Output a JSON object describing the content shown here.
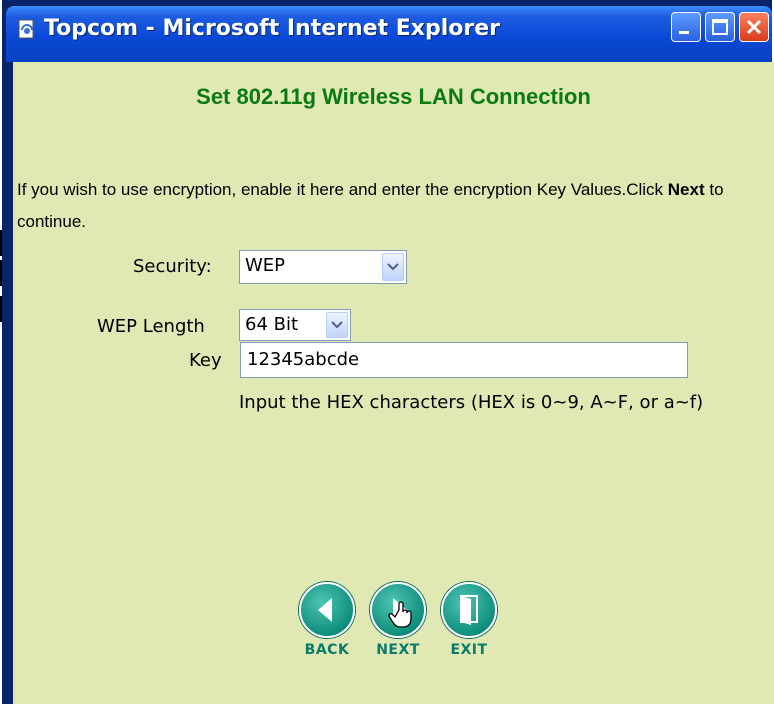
{
  "window": {
    "title": "Topcom - Microsoft Internet Explorer",
    "title_icon": "ie-page-icon",
    "controls": [
      "minimize-icon",
      "maximize-icon",
      "close-icon"
    ]
  },
  "page": {
    "heading": "Set 802.11g Wireless LAN Connection",
    "intro_part1": "If you wish to use encryption, enable it here and enter the encryption Key Values.Click ",
    "intro_bold": "Next",
    "intro_part2": " to continue."
  },
  "form": {
    "security_label": "Security:",
    "security_value": "WEP",
    "wep_length_label": "WEP Length",
    "wep_length_value": "64 Bit",
    "key_label": "Key",
    "key_value": "12345abcde",
    "hint": "Input the HEX characters (HEX is 0~9, A~F, or a~f)"
  },
  "nav": {
    "back": "BACK",
    "next": "NEXT",
    "exit": "EXIT"
  },
  "colors": {
    "background": "#e0e8b4",
    "heading": "#0a7a12",
    "button": "#0e8f7c",
    "titlebar": "#0a49d6"
  }
}
